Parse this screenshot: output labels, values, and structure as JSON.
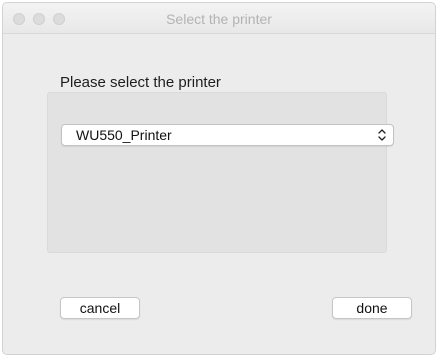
{
  "window": {
    "title": "Select the printer"
  },
  "dialog": {
    "prompt": "Please select the printer",
    "printer_select": {
      "selected_value": "WU550_Printer"
    },
    "buttons": {
      "cancel_label": "cancel",
      "done_label": "done"
    }
  },
  "icons": {
    "close": "close-icon",
    "minimize": "minimize-icon",
    "zoom": "zoom-icon",
    "select_arrows": "chevron-updown-icon"
  },
  "colors": {
    "window_background": "#ececec",
    "panel_background": "#e2e2e2",
    "title_text": "#b3b3b3",
    "inactive_traffic_light": "#dcdcdc"
  }
}
